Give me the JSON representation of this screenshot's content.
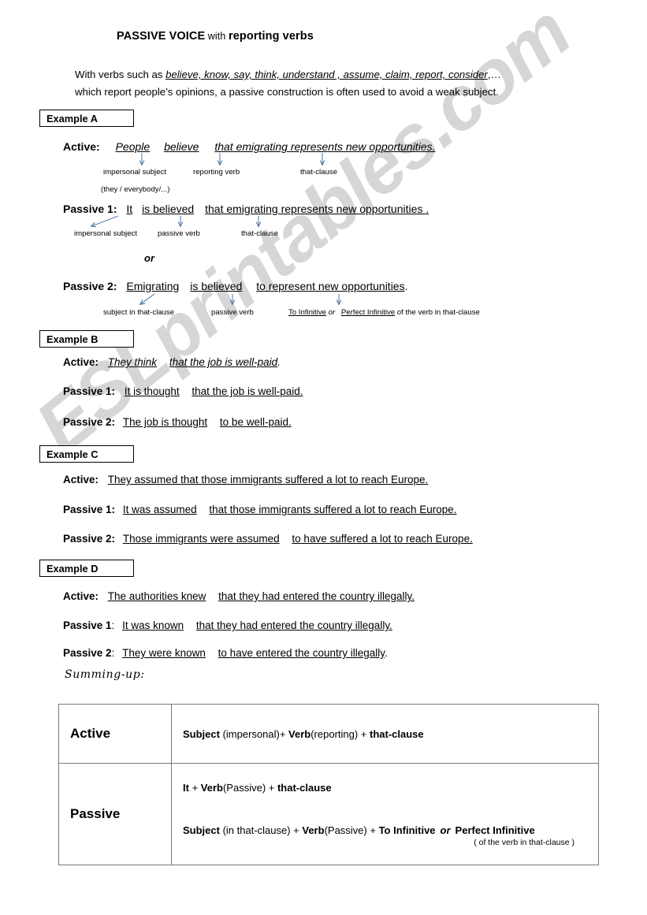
{
  "title": {
    "main": "PASSIVE VOICE",
    "connector": " with ",
    "secondary": "reporting verbs"
  },
  "intro": {
    "lead": "With   verbs  such as ",
    "verbs": "believe, know, say, think, understand , assume, claim, report, consider",
    "tail": ",…",
    "line2": "which report  people’s  opinions, a passive construction is often used to avoid a weak subject."
  },
  "watermark": {
    "text": "ESLprintables.com"
  },
  "examples": {
    "a": {
      "box_label": "Example A",
      "active_label": "Active:",
      "active_p1": "People",
      "active_p2": "believe",
      "active_p3": "that emigrating represents new opportunities.",
      "ann_subject": "impersonal subject",
      "ann_subject2": "(they / everybody/...)",
      "ann_reporting": "reporting verb",
      "ann_thatclause": "that-clause",
      "p1_label": "Passive 1:",
      "p1_s1": "It",
      "p1_s2": "is believed",
      "p1_s3": "that emigrating represents new opportunities .",
      "p1_ann1": "impersonal subject",
      "p1_ann2": "passive verb",
      "p1_ann3": "that-clause",
      "or": "or",
      "p2_label": "Passive 2:",
      "p2_s1": "Emigrating",
      "p2_s2": "is  believed",
      "p2_s3": "to represent new opportunities",
      "p2_period": ".",
      "p2_ann1": "subject  in that-clause",
      "p2_ann2": "passive verb",
      "p2_ann3a": "To Infinitive",
      "p2_ann3b": "or",
      "p2_ann3c": "Perfect Infinitive",
      "p2_ann3d": " of the  verb in that-clause"
    },
    "b": {
      "box_label": "Example B",
      "active_label": "Active:",
      "active_s1": "They think",
      "active_s2": "that the job is well-paid",
      "active_period": ".",
      "p1_label": "Passive 1:",
      "p1_s1": "It is thought",
      "p1_s2": "that the job is well-paid.",
      "p2_label": "Passive 2:",
      "p2_s1": "The job is thought",
      "p2_s2": "to be well-paid."
    },
    "c": {
      "box_label": "Example C",
      "active_label": "Active:",
      "active_s1": "They assumed that   those immigrants suffered a lot to reach Europe.",
      "p1_label": "Passive 1:",
      "p1_s1": "It was assumed",
      "p1_s2": "that  those immigrants suffered a lot to reach Europe.",
      "p2_label": "Passive 2:",
      "p2_s1": "Those immigrants were assumed",
      "p2_s2": "to have suffered a lot to reach Europe."
    },
    "d": {
      "box_label": "Example D",
      "active_label": "Active:",
      "active_s1": "The authorities knew",
      "active_s2": "that they had entered the country illegally.",
      "p1_label": "Passive 1",
      "p1_colon": ":",
      "p1_s1": "It was known",
      "p1_s2": "that they had entered the country illegally.",
      "p2_label": "Passive 2",
      "p2_colon": ":",
      "p2_s1": "They were known",
      "p2_s2": "to have entered the country illegally",
      "p2_period": "."
    }
  },
  "summing_up": {
    "label": "Summing-up:"
  },
  "summary_table": {
    "active_head": "Active",
    "active_body_1": "Subject",
    "active_body_2": " (impersonal)+ ",
    "active_body_3": "Verb",
    "active_body_4": "(reporting) + ",
    "active_body_5": "that-clause",
    "passive_head": "Passive",
    "passive_line1_1": "It",
    "passive_line1_2": " + ",
    "passive_line1_3": "Verb",
    "passive_line1_4": "(Passive) + ",
    "passive_line1_5": "that-clause",
    "passive_line2_1": "Subject",
    "passive_line2_2": " (in that-clause) + ",
    "passive_line2_3": "Verb",
    "passive_line2_4": "(Passive) + ",
    "passive_line2_5": "To Infinitive",
    "passive_line2_6": "or",
    "passive_line2_7": "Perfect Infinitive",
    "passive_subnote": "( of the verb in that-clause )"
  },
  "colors": {
    "arrow": "#5b82a8",
    "table_border": "#7a7a7a",
    "text": "#000000",
    "watermark": "rgba(0,0,0,0.16)"
  }
}
